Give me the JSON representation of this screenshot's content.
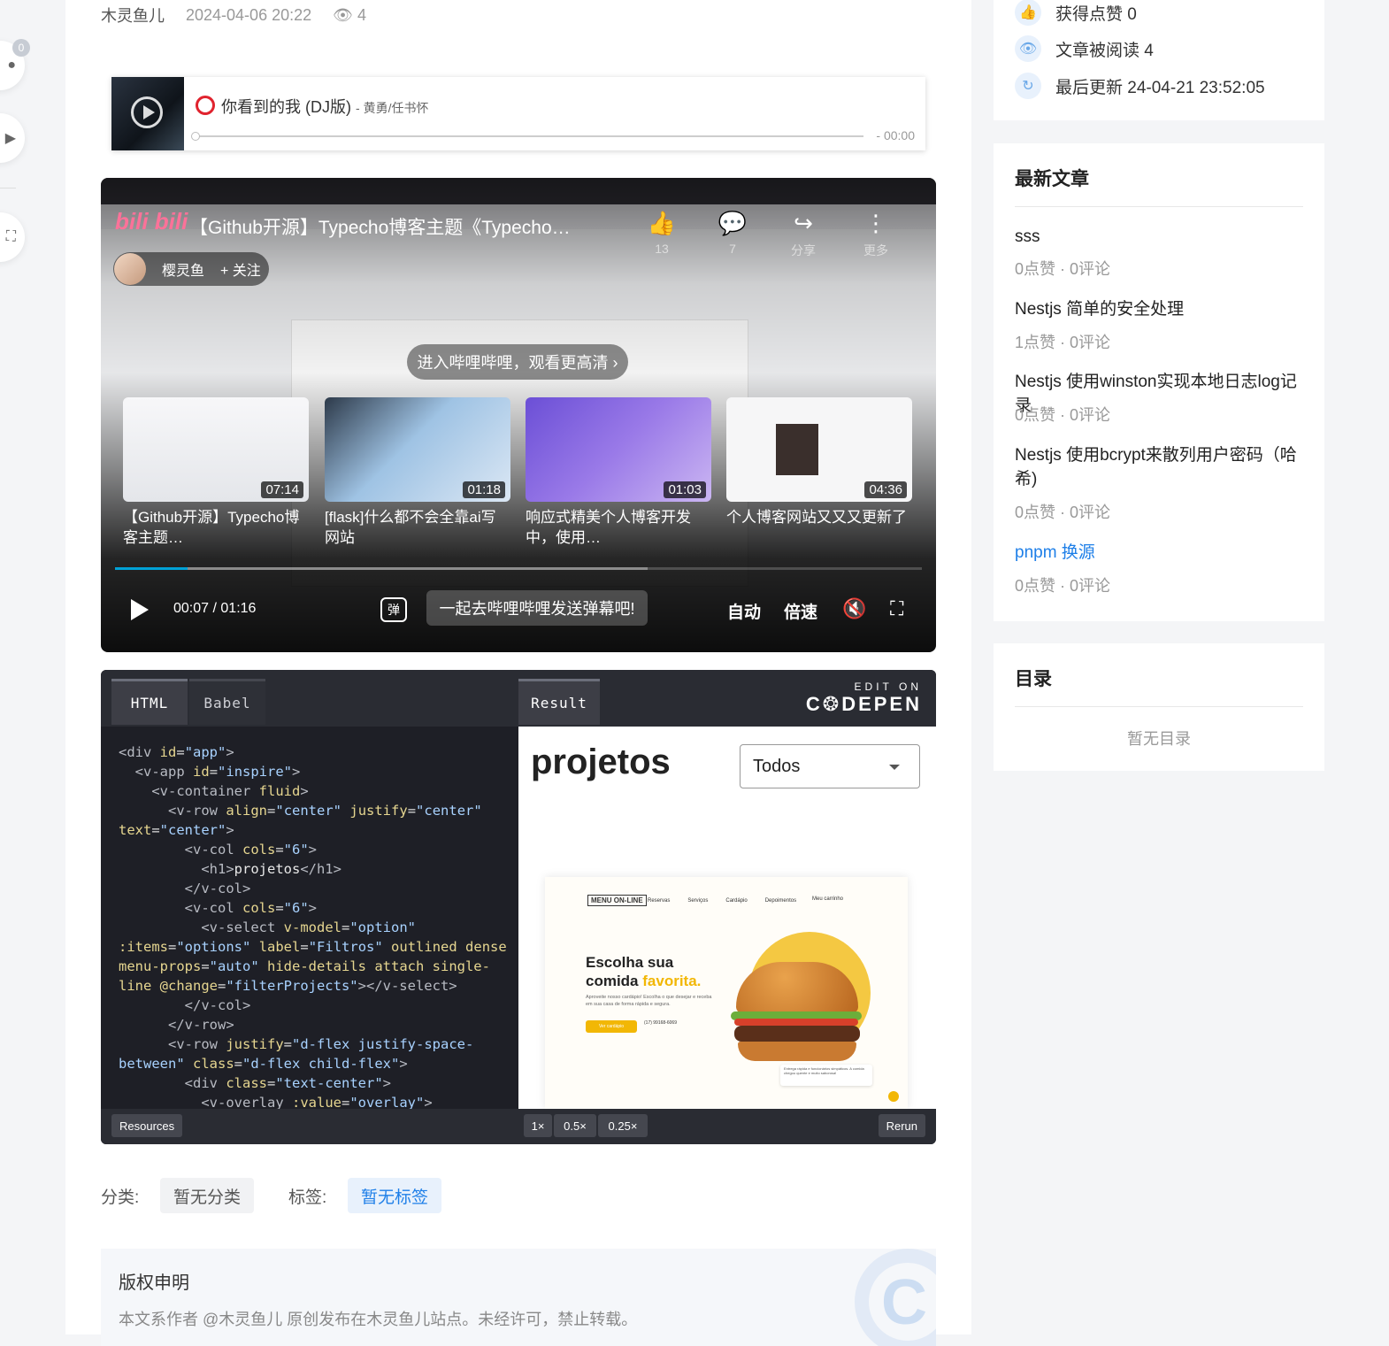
{
  "left_rail": {
    "comment_count": "0"
  },
  "post_meta": {
    "author": "木灵鱼儿",
    "date": "2024-04-06 20:22",
    "views": "4"
  },
  "music": {
    "title": "你看到的我 (DJ版)",
    "artist": "- 黄勇/任书怀",
    "time": "- 00:00"
  },
  "video": {
    "logo": "bili bili",
    "title": "【Github开源】Typecho博客主题《Typecho…",
    "actions": [
      {
        "icon": "thumbs-up-icon",
        "label": "13"
      },
      {
        "icon": "comment-icon",
        "label": "7"
      },
      {
        "icon": "share-icon",
        "label": "分享"
      },
      {
        "icon": "more-icon",
        "label": "更多"
      }
    ],
    "uploader": "樱灵鱼",
    "follow": "+ 关注",
    "hd_prompt": "进入哔哩哔哩，观看更高清 ›",
    "recommendations": [
      {
        "title": "【Github开源】Typecho博客主题…",
        "duration": "07:14"
      },
      {
        "title": "[flask]什么都不会全靠ai写网站",
        "duration": "01:18"
      },
      {
        "title": "响应式精美个人博客开发中，使用…",
        "duration": "01:03"
      },
      {
        "title": "个人博客网站又又又更新了",
        "duration": "04:36"
      }
    ],
    "progress_fraction": 0.09,
    "current_time": "00:07",
    "time_sep": "/",
    "total_time": "01:16",
    "danmaku_icon": "弹",
    "danmaku_placeholder": "一起去哔哩哔哩发送弹幕吧!",
    "auto_label": "自动",
    "speed_label": "倍速"
  },
  "codepen": {
    "tabs": [
      "HTML",
      "Babel",
      "Result"
    ],
    "edit_on": "EDIT ON",
    "brand": "C❂DEPEN",
    "result": {
      "heading": "projetos",
      "select_value": "Todos",
      "shot": {
        "logo": "MENU ON-LINE",
        "nav": [
          "Reservas",
          "Serviços",
          "Cardápio",
          "Depoimentos"
        ],
        "cart": "Meu carrinho",
        "headline1": "Escolha sua",
        "headline2a": "comida ",
        "headline2b": "favorita.",
        "desc": "Aproveite nosso cardápio! Escolha o que desejar e receba em sua casa de forma rápida e segura.",
        "cta": "Ver cardápio",
        "phone": "(17) 99168-6069",
        "note": "Entrega rápida e funcionários simpáticos. A comida chegou quente e muito saborosa!"
      }
    },
    "footer": {
      "resources": "Resources",
      "zoom": [
        "1×",
        "0.5×",
        "0.25×"
      ],
      "rerun": "Rerun"
    }
  },
  "taxonomy": {
    "category_label": "分类:",
    "category_value": "暂无分类",
    "tag_label": "标签:",
    "tag_value": "暂无标签"
  },
  "copyright": {
    "title": "版权申明",
    "text": "本文系作者 @木灵鱼儿 原创发布在木灵鱼儿站点。未经许可，禁止转载。"
  },
  "sidebar": {
    "stats": [
      {
        "icon": "thumbs-up-icon",
        "text": "获得点赞 0"
      },
      {
        "icon": "eye-icon",
        "text": "文章被阅读 4"
      },
      {
        "icon": "refresh-icon",
        "text": "最后更新 24-04-21 23:52:05"
      }
    ],
    "latest_title": "最新文章",
    "latest": [
      {
        "title": "sss",
        "counts": "0点赞 · 0评论"
      },
      {
        "title": "Nestjs 简单的安全处理",
        "counts": "1点赞 · 0评论"
      },
      {
        "title": "Nestjs 使用winston实现本地日志log记录",
        "counts": "0点赞 · 0评论"
      },
      {
        "title": "Nestjs 使用bcrypt来散列用户密码（哈希)",
        "counts": "0点赞 · 0评论"
      },
      {
        "title": "pnpm 换源",
        "counts": "0点赞 · 0评论"
      }
    ],
    "toc_title": "目录",
    "toc_empty": "暂无目录"
  },
  "colors": {
    "accent": "#1e7fe8",
    "bilibili_pink": "#fb7299",
    "bili_progress": "#00a1d6",
    "favorite_yellow": "#f2b705"
  }
}
